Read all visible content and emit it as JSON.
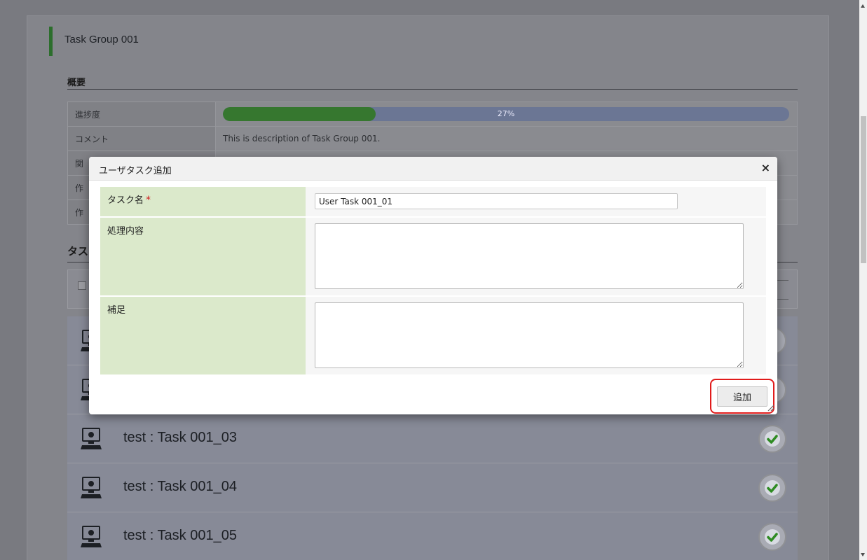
{
  "page": {
    "group_title": "Task Group 001",
    "overview_label": "概要",
    "info_rows": [
      {
        "label": "進捗度",
        "value": ""
      },
      {
        "label": "コメント",
        "value": "This is description of Task Group 001."
      },
      {
        "label": "関",
        "value": ""
      },
      {
        "label": "作",
        "value": ""
      },
      {
        "label": "作",
        "value": ""
      }
    ],
    "progress": {
      "percent": 27,
      "text": "27%"
    },
    "tasks_label": "タス",
    "tasks": [
      {
        "title": ""
      },
      {
        "title": ""
      },
      {
        "title": "test : Task 001_03"
      },
      {
        "title": "test : Task 001_04"
      },
      {
        "title": "test : Task 001_05"
      }
    ]
  },
  "modal": {
    "title": "ユーザタスク追加",
    "close_glyph": "×",
    "fields": {
      "task_name_label": "タスク名",
      "required_mark": "*",
      "task_name_value": "User Task 001_01",
      "process_label": "処理内容",
      "process_value": "",
      "supplement_label": "補足",
      "supplement_value": ""
    },
    "add_button_label": "追加"
  },
  "colors": {
    "progress_fill": "#36772f",
    "label_cell_bg": "#dbe9cb",
    "highlight_border": "#e11b1b",
    "status_check": "#2e8b22"
  }
}
